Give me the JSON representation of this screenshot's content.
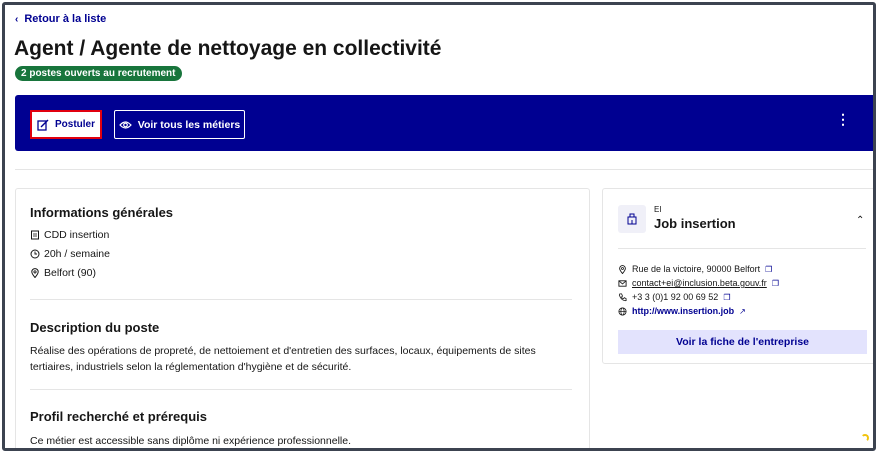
{
  "nav": {
    "back_label": "Retour à la liste"
  },
  "job": {
    "title": "Agent / Agente de nettoyage en collectivité",
    "badge": "2 postes ouverts au recrutement"
  },
  "banner": {
    "apply_label": "Postuler",
    "all_jobs_label": "Voir tous les métiers",
    "more_label": "⋮"
  },
  "general": {
    "title": "Informations générales",
    "contract": "CDD insertion",
    "hours": "20h / semaine",
    "location": "Belfort (90)"
  },
  "description": {
    "title": "Description du poste",
    "text": "Réalise des opérations de propreté, de nettoiement et d'entretien des surfaces, locaux, équipements de sites tertiaires, industriels selon la réglementation d'hygiène et de sécurité."
  },
  "profile": {
    "title": "Profil recherché et prérequis",
    "text": "Ce métier est accessible sans diplôme ni expérience professionnelle."
  },
  "company": {
    "type": "EI",
    "name": "Job insertion",
    "address": "Rue de la victoire, 90000 Belfort",
    "email": "contact+ei@inclusion.beta.gouv.fr",
    "phone": "+3 3 (0)1 92 00 69 52",
    "website": "http://www.insertion.job",
    "cta_label": "Voir la fiche de l'entreprise"
  },
  "colors": {
    "primary": "#000091",
    "badge_green": "#18753c",
    "focus_red": "#e1000f"
  }
}
